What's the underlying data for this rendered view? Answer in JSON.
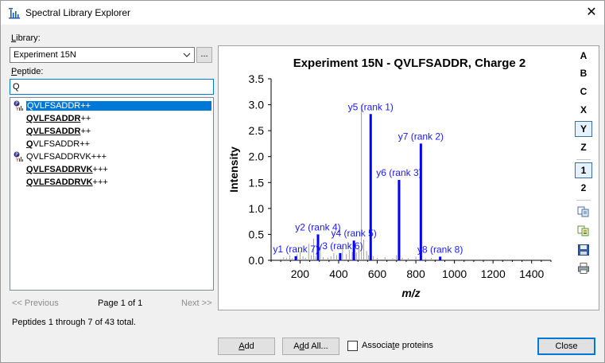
{
  "window": {
    "title": "Spectral Library Explorer",
    "close_glyph": "✕"
  },
  "library": {
    "label_first": "L",
    "label_rest": "ibrary:",
    "selected": "Experiment 15N",
    "browse_label": "..."
  },
  "peptide": {
    "label_first": "P",
    "label_rest": "eptide:",
    "filter_value": "Q"
  },
  "peptides": [
    {
      "plain": "QVLFSADDR",
      "charge": "++",
      "bold_len": 0,
      "icon": true,
      "selected": true
    },
    {
      "bold": "QVLFSADDR",
      "charge": "++",
      "icon": false,
      "selected": false
    },
    {
      "bold": "QVLFSADDR",
      "charge": "++",
      "icon": false,
      "selected": false
    },
    {
      "bold": "Q",
      "rest": "VLFSADDR",
      "charge": "++",
      "icon": false,
      "selected": false
    },
    {
      "plain": "QVLFSADDRVK",
      "charge": "+++",
      "icon": true,
      "selected": false
    },
    {
      "bold": "QVLFSADDRVK",
      "charge": "+++",
      "icon": false,
      "selected": false
    },
    {
      "bold": "QVLFSADDRVK",
      "charge": "+++",
      "icon": false,
      "selected": false
    }
  ],
  "pager": {
    "previous": "<< Previous",
    "page": "Page 1 of 1",
    "next": "Next >>"
  },
  "status": "Peptides 1 through 7 of 43 total.",
  "toolbar": {
    "ion_types": [
      "A",
      "B",
      "C",
      "X",
      "Y",
      "Z"
    ],
    "charges": [
      "1",
      "2"
    ],
    "checked": [
      "Y",
      "1"
    ],
    "icons": [
      "copy-icon",
      "copy-data-icon",
      "save-icon",
      "print-icon"
    ]
  },
  "buttons": {
    "add": "Add",
    "add_first": "A",
    "add_rest": "dd",
    "add_all_pre": "A",
    "add_all_u": "d",
    "add_all_rest": "d All...",
    "associate_pre": "Associa",
    "associate_u": "t",
    "associate_rest": "e proteins",
    "close": "Close"
  },
  "colors": {
    "accent": "#0078d7",
    "ion_blue": "#0000ff",
    "label_blue": "#1a1aff",
    "gray_peak": "#a0a0a0"
  },
  "chart_data": {
    "type": "bar",
    "title": "Experiment 15N - QVLFSADDR, Charge 2",
    "xlabel": "m/z",
    "ylabel": "Intensity",
    "xlim": [
      50,
      1500
    ],
    "ylim": [
      0,
      3.5
    ],
    "x_ticks": [
      200,
      400,
      600,
      800,
      1000,
      1200,
      1400
    ],
    "y_ticks": [
      0.0,
      0.5,
      1.0,
      1.5,
      2.0,
      2.5,
      3.0,
      3.5
    ],
    "annotated_peaks": [
      {
        "label": "y1 (rank 7)",
        "mz": 178,
        "intensity": 0.08
      },
      {
        "label": "y2 (rank 4)",
        "mz": 293,
        "intensity": 0.5
      },
      {
        "label": "y3 (rank 6)",
        "mz": 408,
        "intensity": 0.14
      },
      {
        "label": "y4 (rank 5)",
        "mz": 479,
        "intensity": 0.38
      },
      {
        "label": "y5 (rank 1)",
        "mz": 566,
        "intensity": 2.82
      },
      {
        "label": "y6 (rank 3)",
        "mz": 713,
        "intensity": 1.55
      },
      {
        "label": "y7 (rank 2)",
        "mz": 826,
        "intensity": 2.25
      },
      {
        "label": "y8 (rank 8)",
        "mz": 926,
        "intensity": 0.07
      }
    ],
    "unannotated_peaks": [
      {
        "mz": 100,
        "intensity": 0.03
      },
      {
        "mz": 115,
        "intensity": 0.06
      },
      {
        "mz": 130,
        "intensity": 0.05
      },
      {
        "mz": 147,
        "intensity": 0.1
      },
      {
        "mz": 160,
        "intensity": 0.04
      },
      {
        "mz": 185,
        "intensity": 0.12
      },
      {
        "mz": 200,
        "intensity": 0.18
      },
      {
        "mz": 215,
        "intensity": 0.08
      },
      {
        "mz": 228,
        "intensity": 0.05
      },
      {
        "mz": 245,
        "intensity": 0.32
      },
      {
        "mz": 258,
        "intensity": 0.1
      },
      {
        "mz": 270,
        "intensity": 0.42
      },
      {
        "mz": 280,
        "intensity": 0.07
      },
      {
        "mz": 305,
        "intensity": 0.25
      },
      {
        "mz": 320,
        "intensity": 0.06
      },
      {
        "mz": 345,
        "intensity": 0.05
      },
      {
        "mz": 360,
        "intensity": 0.08
      },
      {
        "mz": 375,
        "intensity": 0.14
      },
      {
        "mz": 390,
        "intensity": 0.1
      },
      {
        "mz": 420,
        "intensity": 0.28
      },
      {
        "mz": 440,
        "intensity": 0.12
      },
      {
        "mz": 455,
        "intensity": 0.2
      },
      {
        "mz": 470,
        "intensity": 0.16
      },
      {
        "mz": 492,
        "intensity": 0.15
      },
      {
        "mz": 505,
        "intensity": 0.22
      },
      {
        "mz": 518,
        "intensity": 3.0
      },
      {
        "mz": 530,
        "intensity": 0.4
      },
      {
        "mz": 545,
        "intensity": 0.18
      },
      {
        "mz": 555,
        "intensity": 0.1
      },
      {
        "mz": 580,
        "intensity": 0.08
      },
      {
        "mz": 600,
        "intensity": 0.05
      },
      {
        "mz": 640,
        "intensity": 0.06
      },
      {
        "mz": 680,
        "intensity": 0.04
      },
      {
        "mz": 700,
        "intensity": 0.1
      },
      {
        "mz": 730,
        "intensity": 0.05
      },
      {
        "mz": 760,
        "intensity": 0.04
      },
      {
        "mz": 800,
        "intensity": 0.07
      },
      {
        "mz": 850,
        "intensity": 0.04
      },
      {
        "mz": 880,
        "intensity": 0.05
      }
    ]
  }
}
